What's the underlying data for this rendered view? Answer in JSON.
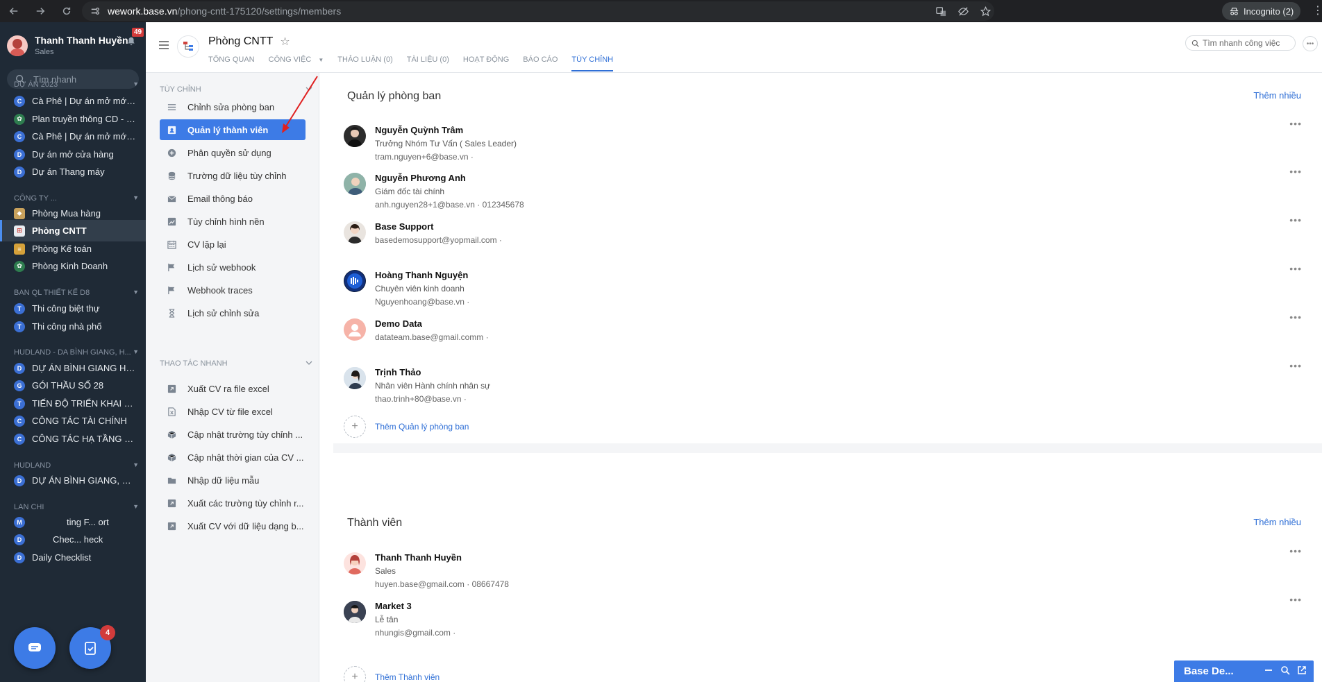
{
  "browser": {
    "url_domain": "wework.base.vn",
    "url_path": "/phong-cntt-175120/settings/members",
    "incognito_label": "Incognito (2)"
  },
  "sidebar": {
    "user_name": "Thanh Thanh Huyền",
    "user_role": "Sales",
    "notif_count": "49",
    "search_placeholder": "Tìm nhanh",
    "groups": [
      {
        "title": "DỰ ÁN 2023",
        "items": [
          {
            "label": "Cà Phê | Dự án mở mới c...",
            "icon": "C"
          },
          {
            "label": "Plan truyền thông CD - M...",
            "icon": "plant"
          },
          {
            "label": "Cà Phê | Dự án mở mới V...",
            "icon": "C"
          },
          {
            "label": "Dự án mở cửa hàng",
            "icon": "D"
          },
          {
            "label": "Dự án Thang máy",
            "icon": "D"
          }
        ]
      },
      {
        "title": "CÔNG TY ...",
        "items": [
          {
            "label": "Phòng Mua hàng",
            "icon": "tag"
          },
          {
            "label": "Phòng CNTT",
            "icon": "grid",
            "active": true
          },
          {
            "label": "Phòng Kế toán",
            "icon": "coins"
          },
          {
            "label": "Phòng Kinh Doanh",
            "icon": "plant"
          }
        ]
      },
      {
        "title": "BAN QL THIẾT KẾ D8",
        "items": [
          {
            "label": "Thi công biệt thự",
            "icon": "T"
          },
          {
            "label": "Thi công nhà phố",
            "icon": "T"
          }
        ]
      },
      {
        "title": "HUDLAND - DA BÌNH GIANG, H...",
        "items": [
          {
            "label": "DỰ ÁN BÌNH GIANG HẢI ...",
            "icon": "D"
          },
          {
            "label": "GÓI THẦU SỐ 28",
            "icon": "G"
          },
          {
            "label": "TIẾN ĐỘ TRIỂN KHAI KIN...",
            "icon": "T"
          },
          {
            "label": "CÔNG TÁC TÀI CHÍNH",
            "icon": "C"
          },
          {
            "label": "CÔNG TÁC HẠ TẦNG KỸ ...",
            "icon": "C"
          }
        ]
      },
      {
        "title": "HUDLAND",
        "items": [
          {
            "label": "DỰ ÁN BÌNH GIANG, HẢI ...",
            "icon": "D"
          }
        ]
      },
      {
        "title": "LAN CHI",
        "items": [
          {
            "label": "ting F... ort",
            "icon": "M"
          },
          {
            "label": "Chec... heck",
            "icon": "D"
          },
          {
            "label": "Daily Checklist",
            "icon": "D"
          }
        ]
      }
    ],
    "fab_badge": "4"
  },
  "header": {
    "project_title": "Phòng CNTT",
    "tabs": [
      "TỔNG QUAN",
      "CÔNG VIỆC",
      "THẢO LUẬN (0)",
      "TÀI LIỆU (0)",
      "HOẠT ĐỘNG",
      "BÁO CÁO",
      "TÙY CHỈNH"
    ],
    "active_tab": "TÙY CHỈNH",
    "task_search_placeholder": "Tìm nhanh công việc"
  },
  "settings_nav": {
    "group1_title": "TÙY CHỈNH",
    "group1_items": [
      {
        "label": "Chỉnh sửa phòng ban",
        "icon": "menu-icon"
      },
      {
        "label": "Quản lý thành viên",
        "icon": "member-icon",
        "active": true
      },
      {
        "label": "Phân quyền sử dụng",
        "icon": "permission-icon"
      },
      {
        "label": "Trường dữ liệu tùy chỉnh",
        "icon": "database-icon"
      },
      {
        "label": "Email thông báo",
        "icon": "email-icon"
      },
      {
        "label": "Tùy chỉnh hình nền",
        "icon": "image-icon"
      },
      {
        "label": "CV lặp lại",
        "icon": "calendar-icon"
      },
      {
        "label": "Lịch sử webhook",
        "icon": "flag-icon"
      },
      {
        "label": "Webhook traces",
        "icon": "flag-icon"
      },
      {
        "label": "Lịch sử chỉnh sửa",
        "icon": "hourglass-icon"
      }
    ],
    "group2_title": "THAO TÁC NHANH",
    "group2_items": [
      {
        "label": "Xuất CV ra file excel",
        "icon": "export-icon"
      },
      {
        "label": "Nhập CV từ file excel",
        "icon": "excel-icon"
      },
      {
        "label": "Cập nhật trường tùy chỉnh ...",
        "icon": "cube-icon"
      },
      {
        "label": "Cập nhật thời gian của CV ...",
        "icon": "cube-icon"
      },
      {
        "label": "Nhập dữ liệu mẫu",
        "icon": "folder-icon"
      },
      {
        "label": "Xuất các trường tùy chỉnh r...",
        "icon": "export-icon"
      },
      {
        "label": "Xuất CV với dữ liệu dạng b...",
        "icon": "export-icon"
      }
    ]
  },
  "main": {
    "managers_title": "Quản lý phòng ban",
    "add_many_label": "Thêm nhiều",
    "managers": [
      {
        "name": "Nguyễn Quỳnh Trâm",
        "title": "Trưởng Nhóm Tư Vấn ( Sales Leader)",
        "contact": "tram.nguyen+6@base.vn ·"
      },
      {
        "name": "Nguyễn Phương Anh",
        "title": "Giám đốc tài chính",
        "contact": "anh.nguyen28+1@base.vn · 012345678"
      },
      {
        "name": "Base Support",
        "title": "",
        "contact": "basedemosupport@yopmail.com ·"
      },
      {
        "name": "Hoàng Thanh Nguyện",
        "title": "Chuyên viên kinh doanh",
        "contact": "Nguyenhoang@base.vn ·"
      },
      {
        "name": "Demo Data",
        "title": "",
        "contact": "datateam.base@gmail.comm ·"
      },
      {
        "name": "Trịnh Thảo",
        "title": "Nhân viên Hành chính nhân sự",
        "contact": "thao.trinh+80@base.vn ·"
      }
    ],
    "add_manager_label": "Thêm Quản lý phòng ban",
    "members_title": "Thành viên",
    "members": [
      {
        "name": "Thanh Thanh Huyền",
        "title": "Sales",
        "contact": "huyen.base@gmail.com · 08667478"
      },
      {
        "name": "Market 3",
        "title": "Lễ tân",
        "contact": "nhungis@gmail.com ·"
      }
    ],
    "add_member_label": "Thêm Thành viên"
  },
  "mini_chat": {
    "title": "Base De..."
  },
  "colors": {
    "accent": "#3d7be6",
    "sidebar_bg": "#1f2a36",
    "link": "#2f6fd6",
    "badge": "#d23b3b"
  }
}
